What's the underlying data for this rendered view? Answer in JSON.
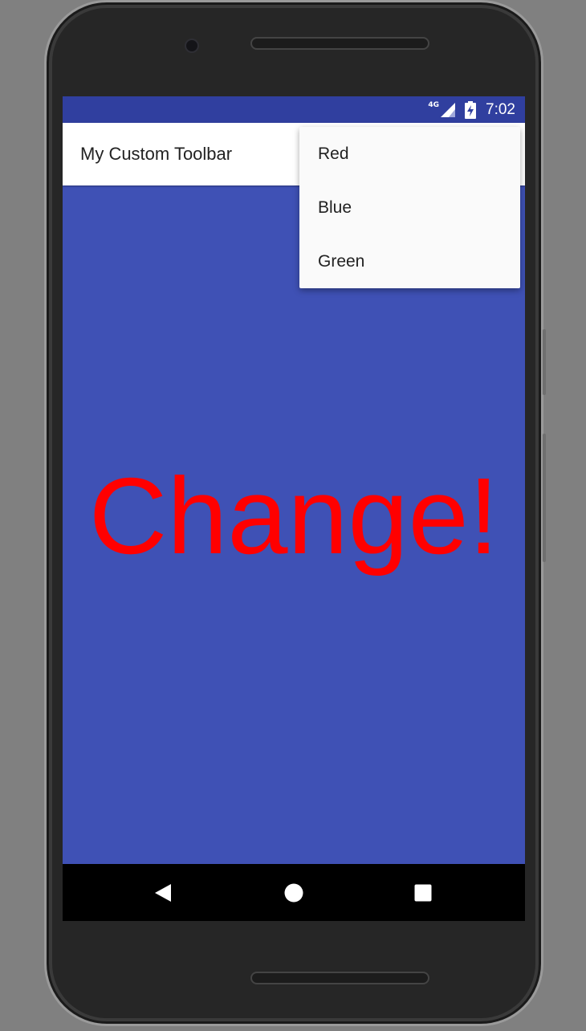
{
  "status_bar": {
    "network_label": "4G",
    "time": "7:02"
  },
  "toolbar": {
    "title": "My Custom Toolbar"
  },
  "overflow_menu": {
    "items": [
      {
        "label": "Red"
      },
      {
        "label": "Blue"
      },
      {
        "label": "Green"
      }
    ]
  },
  "content": {
    "headline": "Change!"
  },
  "colors": {
    "status_bar": "#303F9F",
    "primary_background": "#3F51B5",
    "headline_text": "#FF0000",
    "toolbar": "#FFFFFF",
    "menu_background": "#FAFAFA",
    "nav_bar": "#000000"
  },
  "icons": {
    "signal": "cell-signal-icon",
    "battery": "battery-charging-icon",
    "back": "back-triangle-icon",
    "home": "home-circle-icon",
    "recents": "recents-square-icon"
  }
}
